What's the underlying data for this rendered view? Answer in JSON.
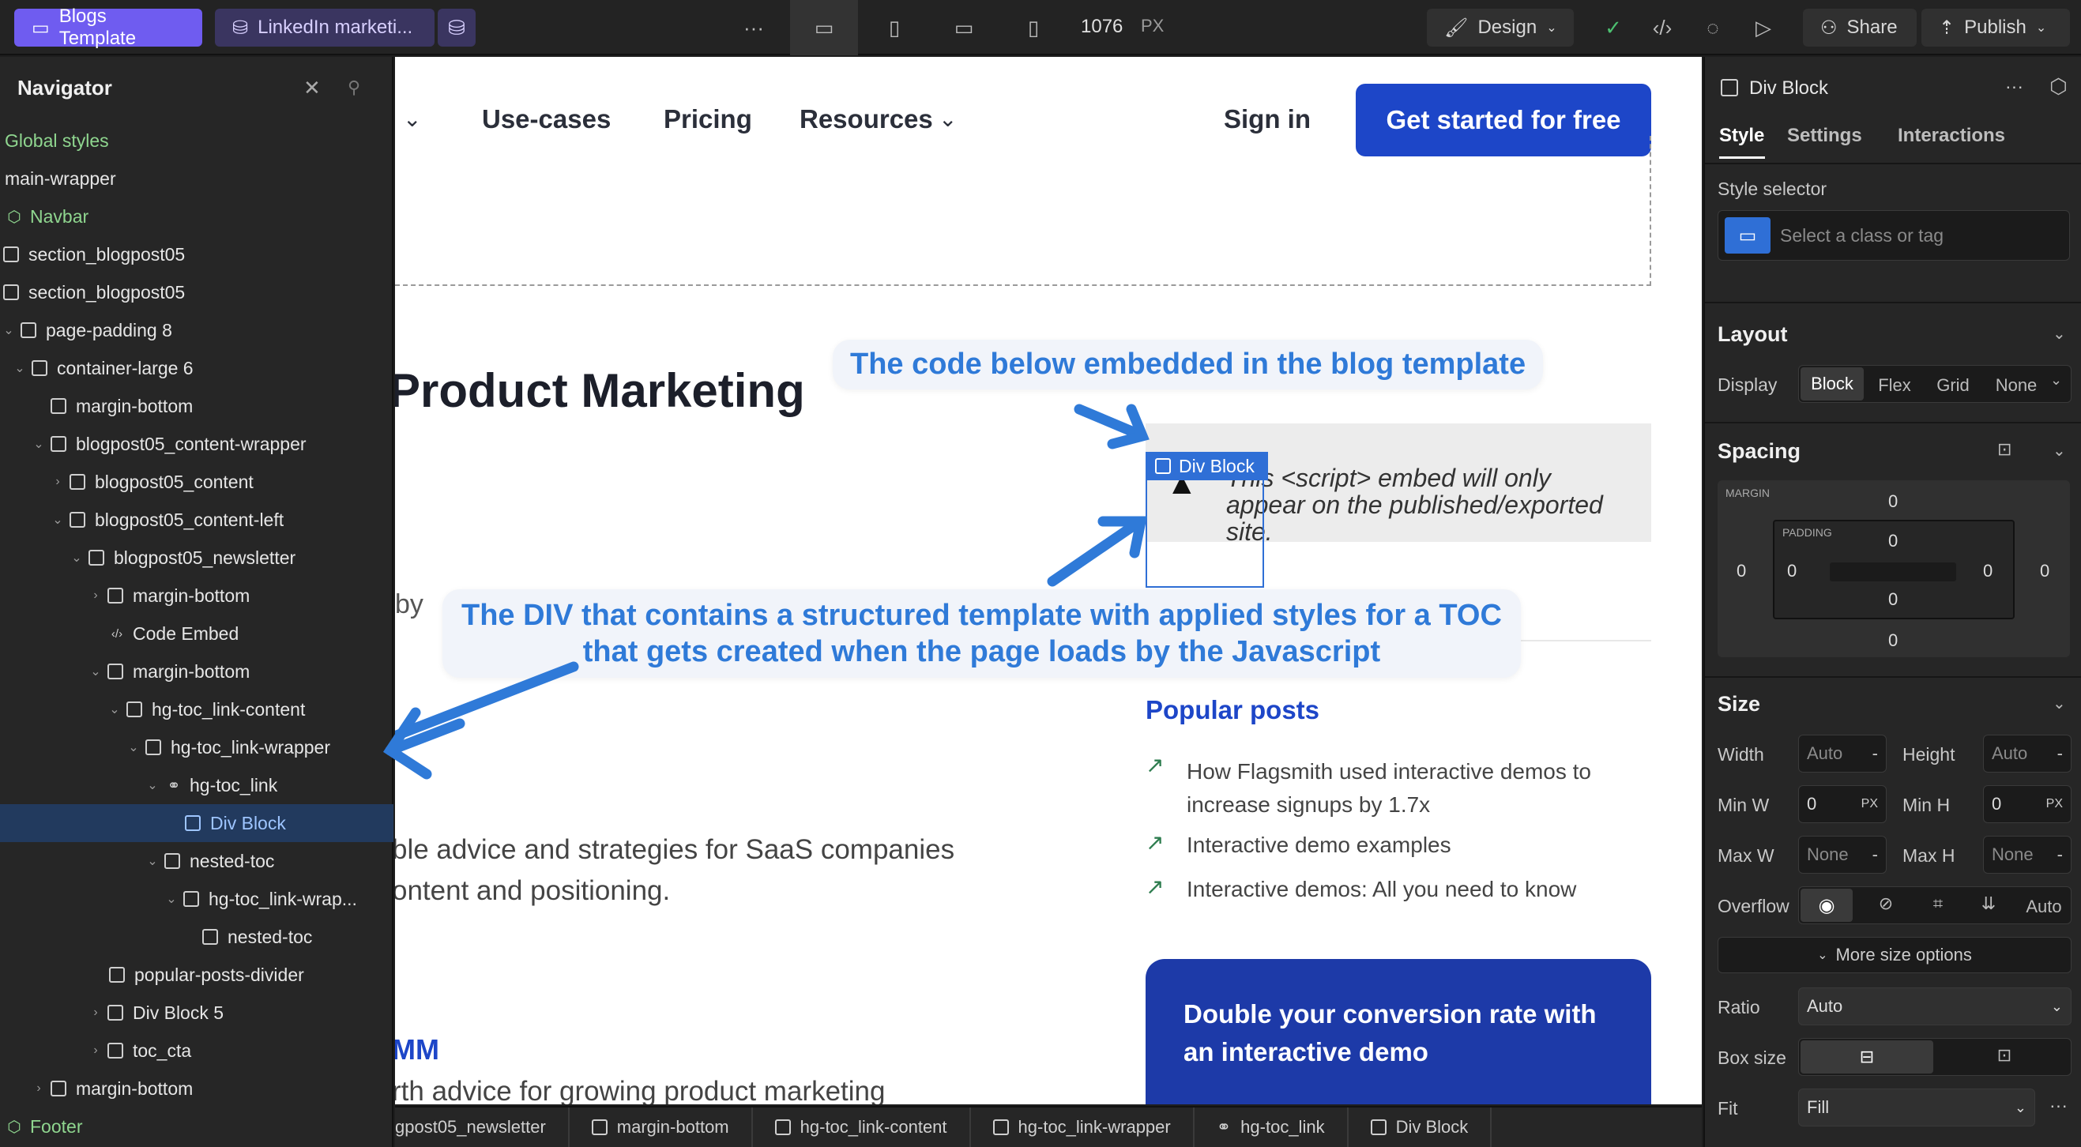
{
  "topbar": {
    "page_tab": "Blogs Template",
    "cms_tab": "LinkedIn marketi...",
    "more": "···",
    "width_value": "1076",
    "width_unit": "PX",
    "mode": "Design",
    "share": "Share",
    "publish": "Publish"
  },
  "navigator": {
    "title": "Navigator",
    "items": [
      {
        "label": "Global styles"
      },
      {
        "label": "main-wrapper"
      },
      {
        "label": "Navbar"
      },
      {
        "label": "section_blogpost05"
      },
      {
        "label": "section_blogpost05"
      },
      {
        "label": "page-padding 8"
      },
      {
        "label": "container-large 6"
      },
      {
        "label": "margin-bottom"
      },
      {
        "label": "blogpost05_content-wrapper"
      },
      {
        "label": "blogpost05_content"
      },
      {
        "label": "blogpost05_content-left"
      },
      {
        "label": "blogpost05_newsletter"
      },
      {
        "label": "margin-bottom"
      },
      {
        "label": "Code Embed"
      },
      {
        "label": "margin-bottom"
      },
      {
        "label": "hg-toc_link-content"
      },
      {
        "label": "hg-toc_link-wrapper"
      },
      {
        "label": "hg-toc_link"
      },
      {
        "label": "Div Block"
      },
      {
        "label": "nested-toc"
      },
      {
        "label": "hg-toc_link-wrap..."
      },
      {
        "label": "nested-toc"
      },
      {
        "label": "popular-posts-divider"
      },
      {
        "label": "Div Block 5"
      },
      {
        "label": "toc_cta"
      },
      {
        "label": "margin-bottom"
      },
      {
        "label": "Footer"
      }
    ]
  },
  "canvas": {
    "nav_links": [
      "Use-cases",
      "Pricing",
      "Resources"
    ],
    "sign_in": "Sign in",
    "cta": "Get started for free",
    "heading": "Product Marketing",
    "embed_badge": "Div Block",
    "embed_notice": "This <script> embed will only appear on the published/exported site.",
    "byline": "by",
    "intro_line1": "ble advice and strategies for SaaS companies",
    "intro_line2": "ontent and positioning.",
    "section_partial": "MM",
    "bottom_partial": "rth advice for growing product marketing",
    "popular_title": "Popular posts",
    "popular_posts": [
      {
        "title": "How Flagsmith used interactive demos to increase signups by 1.7x"
      },
      {
        "title": "Interactive demo examples"
      },
      {
        "title": "Interactive demos: All you need to know"
      }
    ],
    "promo_title": "Double your conversion rate with an interactive demo",
    "annotation_1": "The code below embedded in the blog template",
    "annotation_2_line1": "The DIV that contains a structured template with applied styles for a TOC",
    "annotation_2_line2": "that gets created when the page loads by the Javascript"
  },
  "right_panel": {
    "element": "Div Block",
    "tabs": [
      "Style",
      "Settings",
      "Interactions"
    ],
    "style_selector_label": "Style selector",
    "style_selector_placeholder": "Select a class or tag",
    "layout_title": "Layout",
    "display_label": "Display",
    "display_options": [
      "Block",
      "Flex",
      "Grid",
      "None"
    ],
    "spacing_title": "Spacing",
    "margin_label": "MARGIN",
    "padding_label": "PADDING",
    "spacing_value": "0",
    "size_title": "Size",
    "width_label": "Width",
    "height_label": "Height",
    "min_w_label": "Min W",
    "min_h_label": "Min H",
    "max_w_label": "Max W",
    "max_h_label": "Max H",
    "auto": "Auto",
    "none": "None",
    "dash": "-",
    "px": "PX",
    "overflow_label": "Overflow",
    "more_size": "More size options",
    "ratio_label": "Ratio",
    "box_size_label": "Box size",
    "fit_label": "Fit",
    "fit_value": "Fill",
    "more": "···"
  },
  "breadcrumb": [
    "gpost05_newsletter",
    "margin-bottom",
    "hg-toc_link-content",
    "hg-toc_link-wrapper",
    "hg-toc_link",
    "Div Block"
  ],
  "colors": {
    "accent": "#1d46c8",
    "selection": "#2f6fd6",
    "annotation": "#2f7ad8",
    "page_tab": "#6f5cf0",
    "green": "#4cbf70"
  }
}
